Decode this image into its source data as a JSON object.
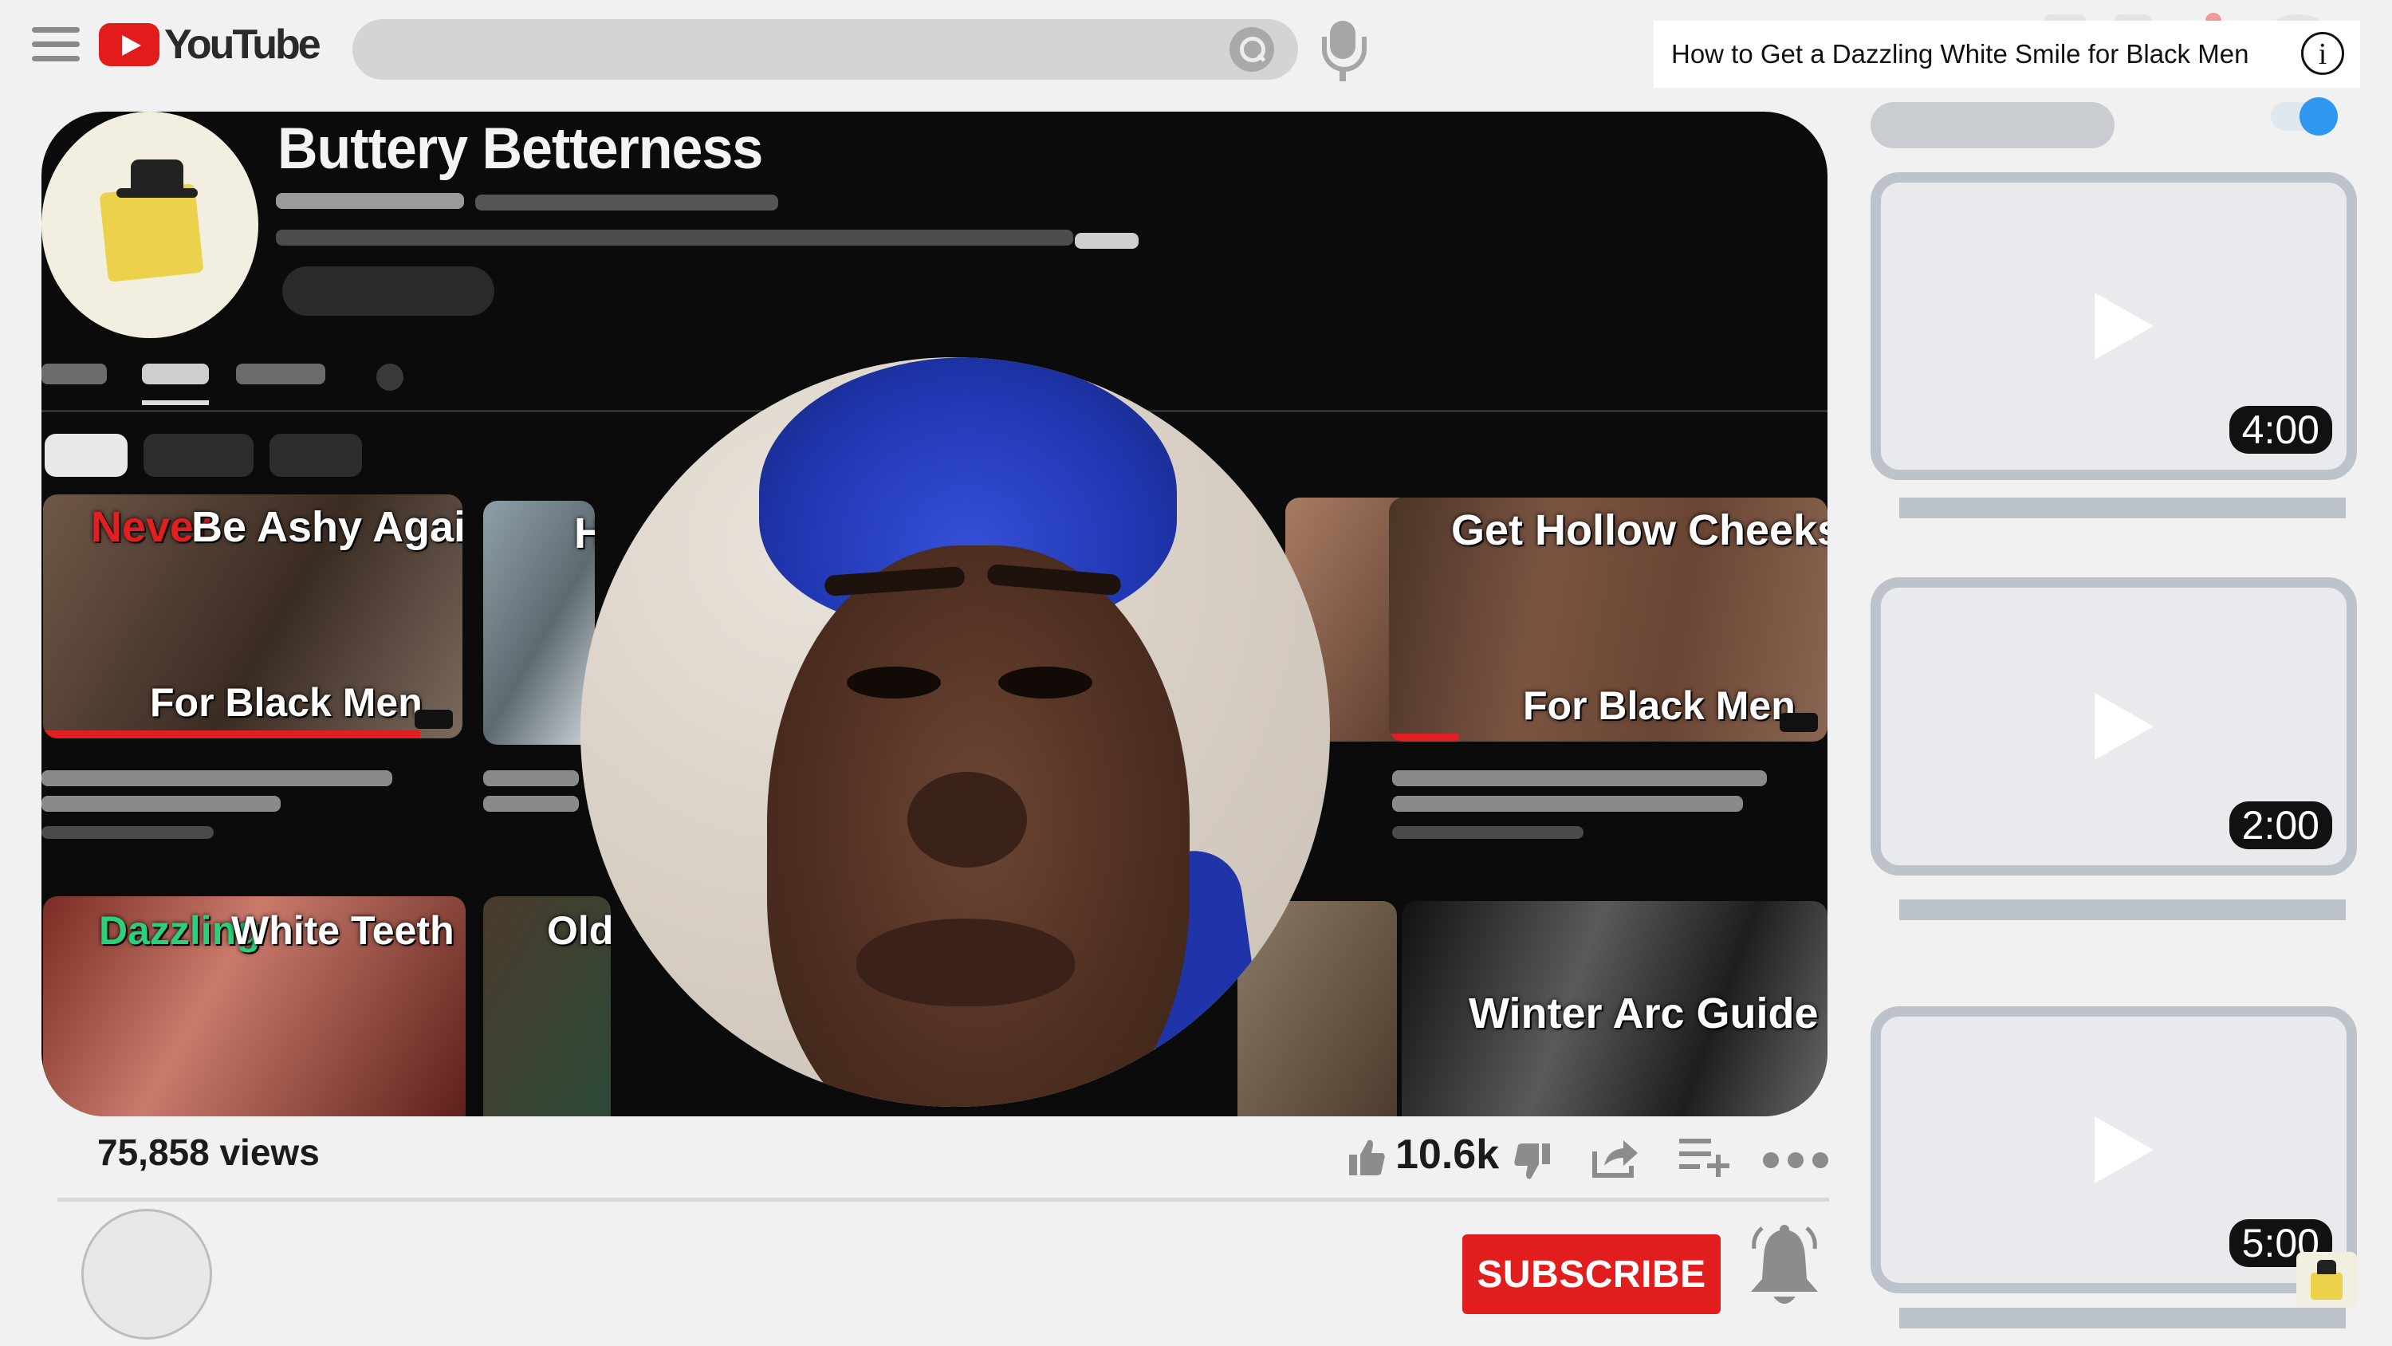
{
  "header": {
    "logo_text": "YouTube",
    "icons": [
      "menu-icon",
      "youtube-play-icon",
      "search-icon",
      "microphone-icon"
    ]
  },
  "info_card": {
    "title": "How to Get a Dazzling White Smile for Black Men",
    "icon": "info-icon",
    "icon_glyph": "i"
  },
  "video": {
    "channel_name": "Buttery Betterness",
    "thumbnails": [
      {
        "caption_accent": "Never",
        "caption_main": "Be Ashy Again",
        "caption_bottom": "For Black Men"
      },
      {
        "caption_main": "Hai"
      },
      {
        "caption_main": "Get Hollow Cheeks",
        "caption_bottom": "For Black Men"
      },
      {
        "caption_accent": "Dazzling",
        "caption_main": "White Teeth"
      },
      {
        "caption_main": "Old M"
      },
      {
        "caption_main": "Winter Arc Guide"
      }
    ]
  },
  "stats": {
    "views": "75,858 views",
    "likes": "10.6k"
  },
  "subscribe": {
    "label": "SUBSCRIBE",
    "color": "#e11d1d"
  },
  "sidebar": {
    "autoplay_color": "#2f97ef",
    "cards": [
      {
        "duration": "4:00"
      },
      {
        "duration": "2:00"
      },
      {
        "duration": "5:00"
      }
    ]
  }
}
